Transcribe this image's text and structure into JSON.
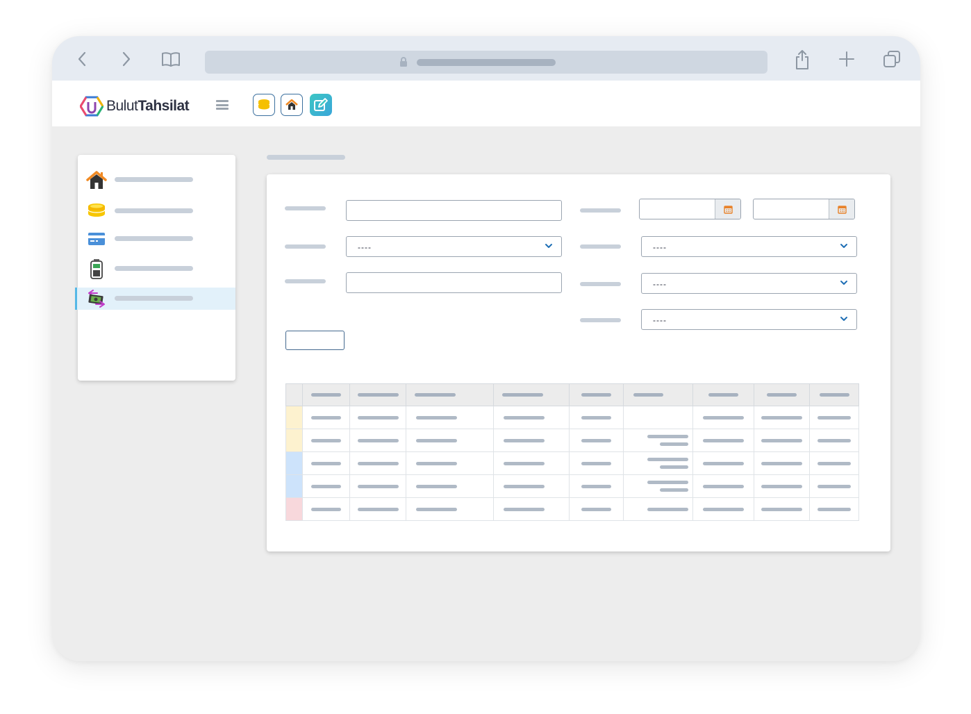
{
  "app": {
    "brand_light": "Bulut",
    "brand_bold": "Tahsilat",
    "brand_colors": [
      "#ef4b6c",
      "#f5b400",
      "#2bb673",
      "#3a7bd5",
      "#8e44ad"
    ]
  },
  "browser": {
    "icons": [
      "back-icon",
      "forward-icon",
      "bookmarks-icon",
      "lock-icon",
      "share-icon",
      "new-tab-icon",
      "tabs-icon"
    ]
  },
  "toolbar": {
    "quick_buttons": [
      {
        "icon": "coins-icon",
        "color": "#f5c000"
      },
      {
        "icon": "home-icon",
        "color": "#f08a24"
      },
      {
        "icon": "edit-icon",
        "color": "#3cc6c4"
      }
    ]
  },
  "sidebar": {
    "items": [
      {
        "icon": "home-icon",
        "active": false
      },
      {
        "icon": "coins-icon",
        "active": false
      },
      {
        "icon": "credit-card-icon",
        "active": false
      },
      {
        "icon": "pos-terminal-icon",
        "active": false
      },
      {
        "icon": "money-transfer-icon",
        "active": true
      }
    ]
  },
  "form": {
    "select_placeholder": "----",
    "selects": [
      {
        "value": "----"
      },
      {
        "value": "----"
      },
      {
        "value": "----"
      },
      {
        "value": "----"
      }
    ]
  },
  "table": {
    "columns": 10,
    "row_status_colors": {
      "yellow": "#fdf2cf",
      "blue": "#cde3fb",
      "red": "#f8d8dc"
    },
    "rows": [
      {
        "status": "yellow"
      },
      {
        "status": "yellow"
      },
      {
        "status": "blue"
      },
      {
        "status": "blue"
      },
      {
        "status": "red"
      }
    ]
  }
}
